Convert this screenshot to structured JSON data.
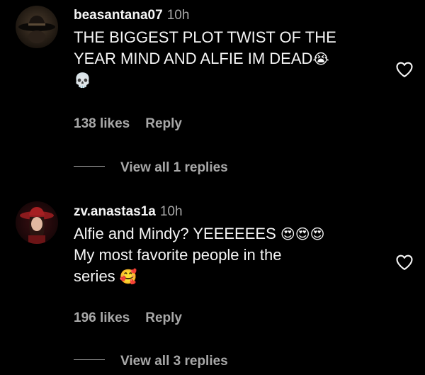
{
  "comments": [
    {
      "username": "beasantana07",
      "time": "10h",
      "lines": [
        "THE BIGGEST PLOT TWIST OF THE",
        "YEAR MIND AND ALFIE IM DEAD",
        ""
      ],
      "emoji_line2": "😭",
      "emoji_line3": "💀",
      "likes": "138 likes",
      "reply": "Reply",
      "view_replies": "View all 1 replies",
      "avatar_icon": "cowboy-hat-avatar"
    },
    {
      "username": "zv.anastas1a",
      "time": "10h",
      "lines": [
        "Alfie and Mindy? YEEEEEES",
        "My most favorite people in the",
        "series"
      ],
      "emoji_line1": "😍😍😍",
      "emoji_line3": "🥰",
      "likes": "196 likes",
      "reply": "Reply",
      "view_replies": "View all 3 replies",
      "avatar_icon": "red-hat-woman-avatar"
    }
  ],
  "colors": {
    "background": "#000000",
    "primary_text": "#f5f5f5",
    "secondary_text": "#a8a8a8"
  }
}
